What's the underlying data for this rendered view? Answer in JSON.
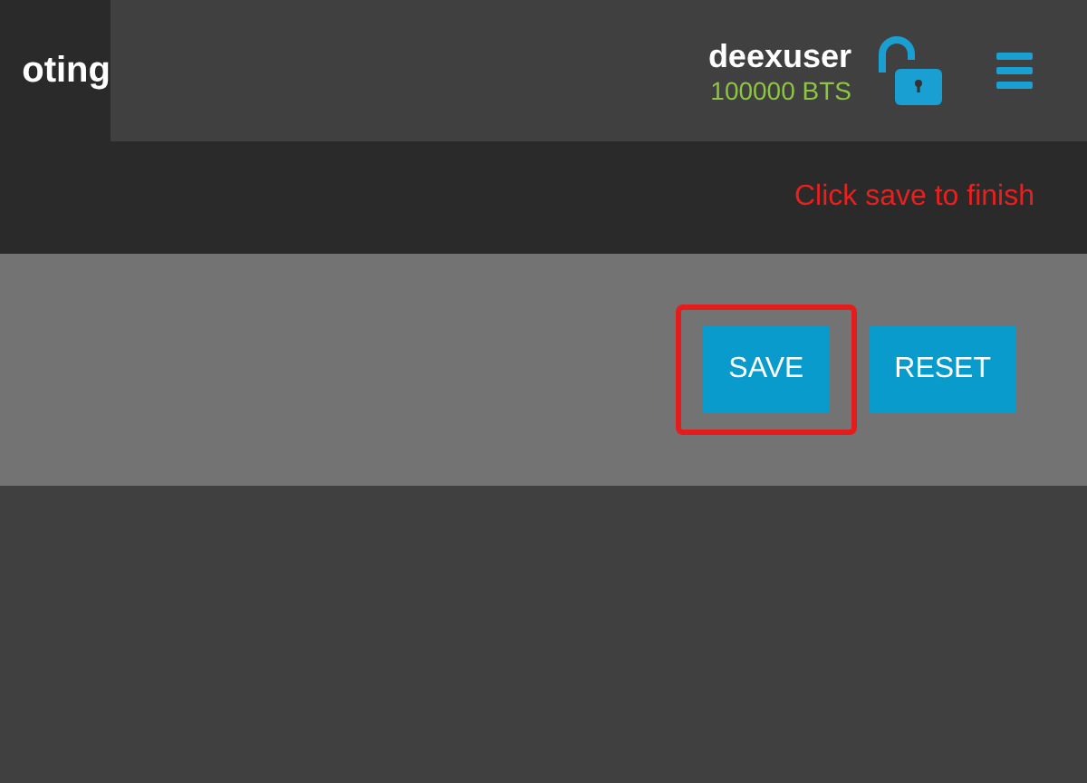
{
  "header": {
    "tab": {
      "label": "oting",
      "selected": true
    },
    "account": {
      "name": "deexuser",
      "balance": "100000 BTS"
    }
  },
  "notice": "Click save to finish",
  "buttons": [
    {
      "label": "SAVE",
      "highlighted": true
    },
    {
      "label": "RESET",
      "highlighted": false
    }
  ]
}
